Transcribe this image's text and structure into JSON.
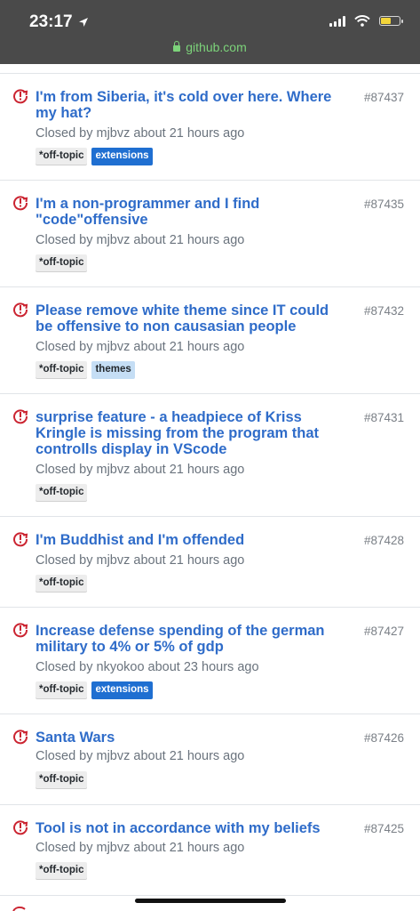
{
  "status_bar": {
    "time": "23:17",
    "url": "github.com"
  },
  "issues": [
    {
      "title": "I'm from Siberia, it's cold over here. Where my hat?",
      "number": "#87437",
      "meta": "Closed by mjbvz about 21 hours ago",
      "labels": [
        "*off-topic",
        "extensions"
      ]
    },
    {
      "title": "I'm a non-programmer and I find \"code\"offensive",
      "number": "#87435",
      "meta": "Closed by mjbvz about 21 hours ago",
      "labels": [
        "*off-topic"
      ]
    },
    {
      "title": "Please remove white theme since IT could be offensive to non causasian people",
      "number": "#87432",
      "meta": "Closed by mjbvz about 21 hours ago",
      "labels": [
        "*off-topic",
        "themes"
      ]
    },
    {
      "title": "surprise feature - a headpiece of Kriss Kringle is missing from the program that controlls display in VScode",
      "number": "#87431",
      "meta": "Closed by mjbvz about 21 hours ago",
      "labels": [
        "*off-topic"
      ]
    },
    {
      "title": "I'm Buddhist and I'm offended",
      "number": "#87428",
      "meta": "Closed by mjbvz about 21 hours ago",
      "labels": [
        "*off-topic"
      ]
    },
    {
      "title": "Increase defense spending of the german military to 4% or 5% of gdp",
      "number": "#87427",
      "meta": "Closed by nkyokoo about 23 hours ago",
      "labels": [
        "*off-topic",
        "extensions"
      ]
    },
    {
      "title": "Santa Wars",
      "number": "#87426",
      "meta": "Closed by mjbvz about 21 hours ago",
      "labels": [
        "*off-topic"
      ]
    },
    {
      "title": "Tool is not in accordance with my beliefs",
      "number": "#87425",
      "meta": "Closed by mjbvz about 21 hours ago",
      "labels": [
        "*off-topic"
      ]
    }
  ],
  "colors": {
    "title_link": "#2f6cc9",
    "closed_icon": "#cb2431",
    "label_extensions": "#1f6fd1",
    "label_themes": "#c5def5",
    "label_offtopic": "#ededed"
  }
}
